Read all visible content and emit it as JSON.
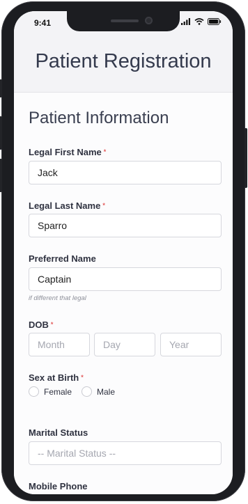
{
  "status": {
    "time": "9:41"
  },
  "header": {
    "title": "Patient Registration"
  },
  "section": {
    "title": "Patient Information"
  },
  "fields": {
    "first_name": {
      "label": "Legal First Name",
      "value": "Jack"
    },
    "last_name": {
      "label": "Legal Last Name",
      "value": "Sparro"
    },
    "preferred_name": {
      "label": "Preferred Name",
      "value": "Captain",
      "hint": "if different that legal"
    },
    "dob": {
      "label": "DOB",
      "month_placeholder": "Month",
      "day_placeholder": "Day",
      "year_placeholder": "Year"
    },
    "sex": {
      "label": "Sex at Birth",
      "options": [
        "Female",
        "Male"
      ]
    },
    "marital": {
      "label": "Marital Status",
      "placeholder": "-- Marital Status --"
    },
    "mobile": {
      "label": "Mobile Phone"
    }
  },
  "required_marker": "*",
  "icons": [
    "signal-icon",
    "wifi-icon",
    "battery-icon"
  ]
}
